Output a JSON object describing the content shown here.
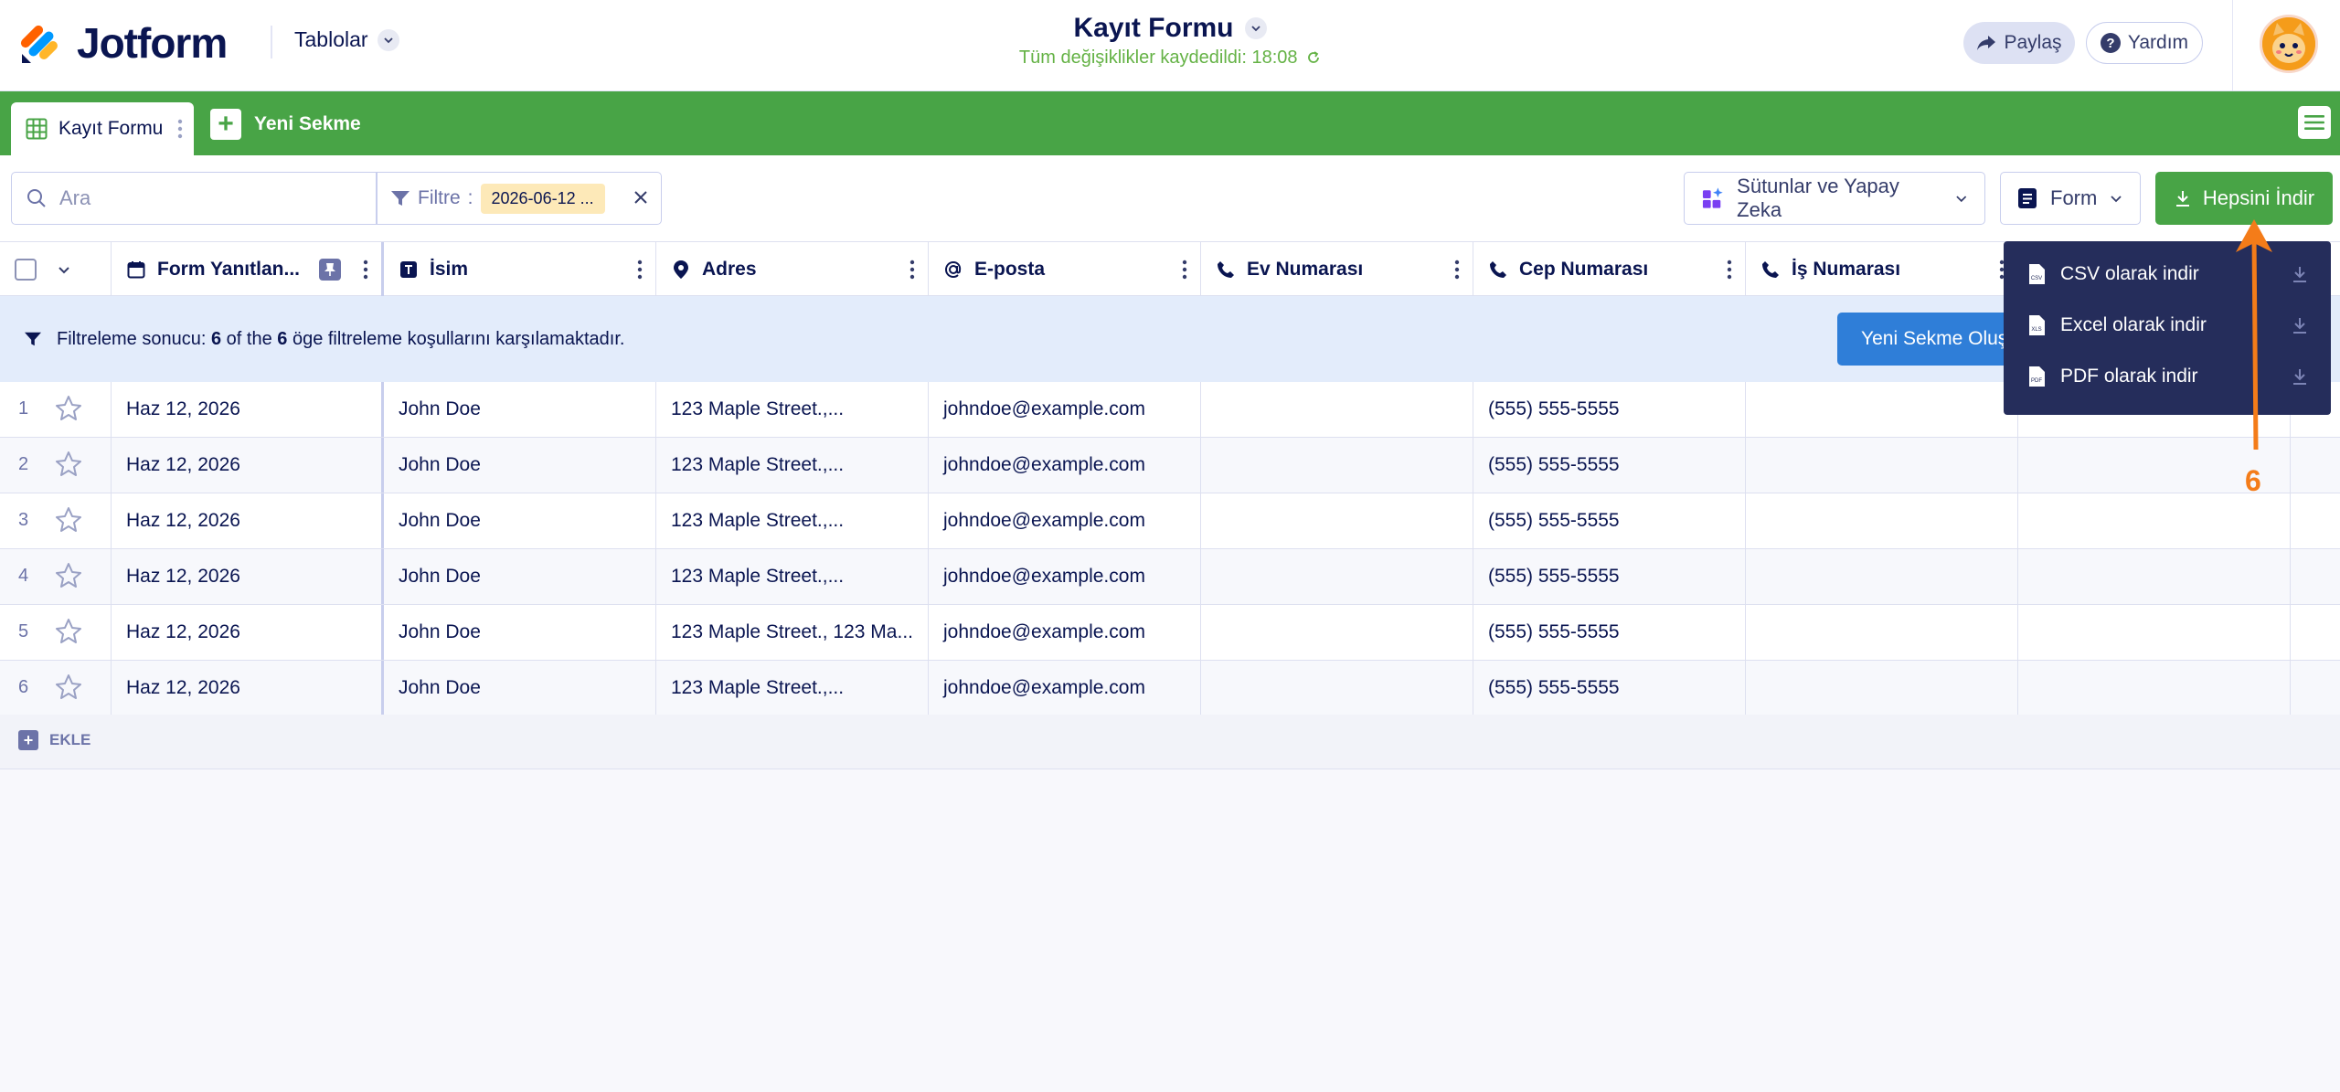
{
  "header": {
    "logo_text": "Jotform",
    "tables_nav": "Tablolar",
    "title": "Kayıt Formu",
    "save_status": "Tüm değişiklikler kaydedildi: 18:08",
    "share_label": "Paylaş",
    "help_label": "Yardım"
  },
  "tabs": {
    "active_tab": "Kayıt Formu",
    "new_tab": "Yeni Sekme"
  },
  "toolbar": {
    "search_placeholder": "Ara",
    "filter_label": "Filtre",
    "filter_value": "2026-06-12 ...",
    "columns_ai_label": "Sütunlar ve Yapay Zeka",
    "form_label": "Form",
    "download_all_label": "Hepsini İndir"
  },
  "table": {
    "columns": [
      "Form Yanıtlan...",
      "İsim",
      "Adres",
      "E-posta",
      "Ev Numarası",
      "Cep Numarası",
      "İş Numarası"
    ],
    "filter_banner": {
      "prefix": "Filtreleme sonucu:",
      "count": "6",
      "of_the": "of the",
      "total": "6",
      "suffix": "öge filtreleme koşullarını karşılamaktadır."
    },
    "create_tab_button": "Yeni Sekme Oluştur",
    "rows": [
      {
        "num": "1",
        "date": "Haz 12, 2026",
        "name": "John Doe",
        "address": "123 Maple Street.,...",
        "email": "johndoe@example.com",
        "home": "",
        "mobile": "(555) 555-5555",
        "work": ""
      },
      {
        "num": "2",
        "date": "Haz 12, 2026",
        "name": "John Doe",
        "address": "123 Maple Street.,...",
        "email": "johndoe@example.com",
        "home": "",
        "mobile": "(555) 555-5555",
        "work": ""
      },
      {
        "num": "3",
        "date": "Haz 12, 2026",
        "name": "John Doe",
        "address": "123 Maple Street.,...",
        "email": "johndoe@example.com",
        "home": "",
        "mobile": "(555) 555-5555",
        "work": ""
      },
      {
        "num": "4",
        "date": "Haz 12, 2026",
        "name": "John Doe",
        "address": "123 Maple Street.,...",
        "email": "johndoe@example.com",
        "home": "",
        "mobile": "(555) 555-5555",
        "work": ""
      },
      {
        "num": "5",
        "date": "Haz 12, 2026",
        "name": "John Doe",
        "address": "123 Maple Street., 123 Ma...",
        "email": "johndoe@example.com",
        "home": "",
        "mobile": "(555) 555-5555",
        "work": ""
      },
      {
        "num": "6",
        "date": "Haz 12, 2026",
        "name": "John Doe",
        "address": "123 Maple Street.,...",
        "email": "johndoe@example.com",
        "home": "",
        "mobile": "(555) 555-5555",
        "work": ""
      }
    ],
    "add_label": "EKLE"
  },
  "download_menu": {
    "items": [
      "CSV olarak indir",
      "Excel olarak indir",
      "PDF olarak indir"
    ],
    "file_tags": [
      "CSV",
      "XLS",
      "PDF"
    ]
  },
  "annotation": {
    "number": "6"
  },
  "colors": {
    "brand_green": "#48a446",
    "navy": "#0a1551",
    "dropdown_bg": "#252d5b",
    "accent_orange": "#f47c19",
    "banner_blue": "#e3ecfb",
    "button_blue": "#2f7ed8"
  }
}
